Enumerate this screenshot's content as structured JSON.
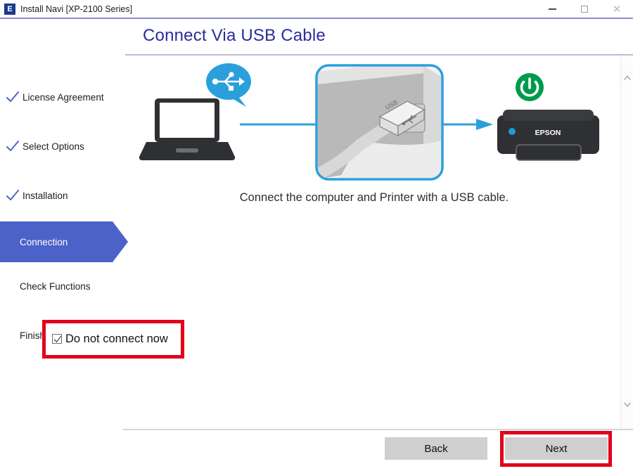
{
  "window": {
    "app_icon": "epson-e-icon",
    "title": "Install Navi [XP-2100 Series]",
    "minimize_label": "Minimize",
    "maximize_label": "Maximize",
    "close_label": "Close"
  },
  "header": {
    "title": "Connect Via USB Cable"
  },
  "sidebar": {
    "items": [
      {
        "label": "License Agreement",
        "state": "done"
      },
      {
        "label": "Select Options",
        "state": "done"
      },
      {
        "label": "Installation",
        "state": "done"
      },
      {
        "label": "Connection",
        "state": "current"
      },
      {
        "label": "Check Functions",
        "state": "pending"
      },
      {
        "label": "Finish",
        "state": "pending"
      }
    ]
  },
  "main": {
    "illustration": {
      "computer_icon": "laptop-icon",
      "usb_bubble_icon": "usb-speech-bubble-icon",
      "usb_port_photo": "usb-cable-port-photo",
      "usb_port_label": "USB",
      "printer_icon": "printer-icon",
      "printer_brand": "EPSON",
      "power_icon": "power-button-icon",
      "arrow_icon": "arrow-right-icon"
    },
    "caption": "Connect the computer and Printer with a USB cable.",
    "checkbox": {
      "label": "Do not connect now",
      "checked": true,
      "highlighted": true
    }
  },
  "footer": {
    "back_label": "Back",
    "next_label": "Next",
    "next_highlighted": true
  },
  "scrollbar": {
    "up_arrow": "chevron-up-icon",
    "down_arrow": "chevron-down-icon"
  },
  "colors": {
    "accent_blue": "#4d62c9",
    "title_blue": "#2b2b9e",
    "illustration_blue": "#2b9fdc",
    "highlight_red": "#e2001a",
    "power_green": "#009a4e",
    "button_gray": "#cfcfcf"
  }
}
